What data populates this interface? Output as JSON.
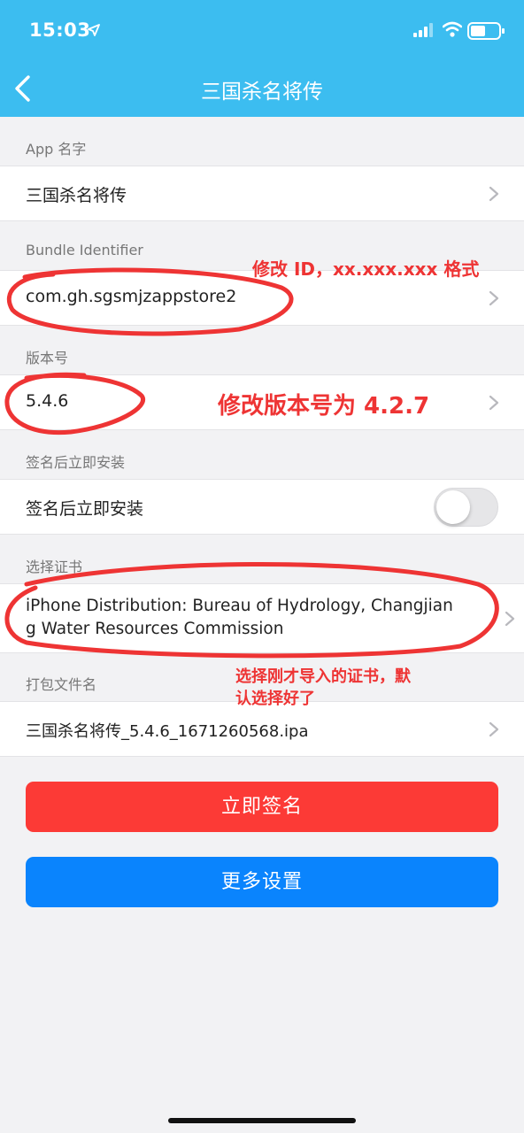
{
  "status_bar": {
    "time": "15:03"
  },
  "nav": {
    "title": "三国杀名将传"
  },
  "sections": {
    "app_name": {
      "label": "App 名字",
      "value": "三国杀名将传"
    },
    "bundle_id": {
      "label": "Bundle Identifier",
      "value": "com.gh.sgsmjzappstore2"
    },
    "version": {
      "label": "版本号",
      "value": "5.4.6"
    },
    "install": {
      "label": "签名后立即安装",
      "row_label": "签名后立即安装",
      "toggle_on": false
    },
    "certificate": {
      "label": "选择证书",
      "value_line1": "iPhone Distribution: Bureau of Hydrology, Changjian",
      "value_line2": "g Water Resources Commission"
    },
    "package_name": {
      "label": "打包文件名",
      "value": "三国杀名将传_5.4.6_1671260568.ipa"
    }
  },
  "buttons": {
    "sign_now": "立即签名",
    "more_settings": "更多设置"
  },
  "annotations": {
    "bundle_note": "修改 ID，xx.xxx.xxx 格式",
    "version_note": "修改版本号为 4.2.7",
    "cert_note_line1": "选择刚才导入的证书，默",
    "cert_note_line2": "认选择好了"
  },
  "colors": {
    "header": "#3cbdf0",
    "sign_button": "#fc3a36",
    "more_button": "#0a84fd",
    "annotation": "#ee3434"
  }
}
